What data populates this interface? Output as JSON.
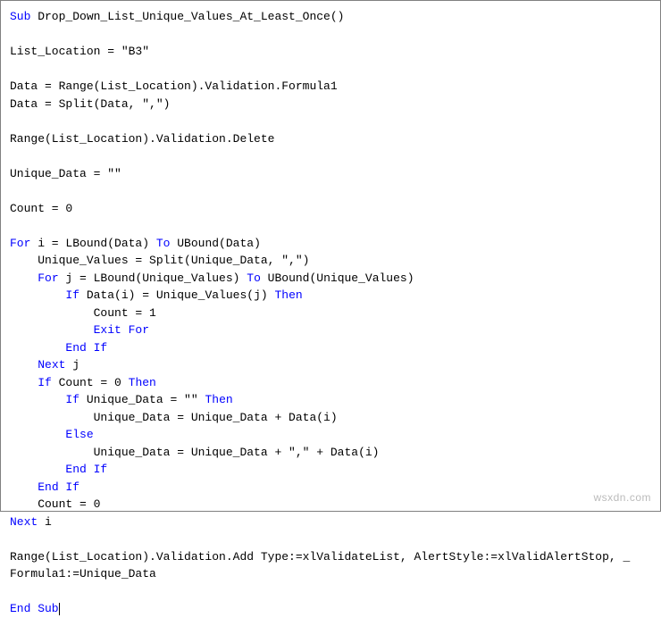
{
  "code": {
    "l1_kw1": "Sub",
    "l1_norm": " Drop_Down_List_Unique_Values_At_Least_Once()",
    "l3": "List_Location = \"B3\"",
    "l5": "Data = Range(List_Location).Validation.Formula1",
    "l6": "Data = Split(Data, \",\")",
    "l8": "Range(List_Location).Validation.Delete",
    "l10": "Unique_Data = \"\"",
    "l12": "Count = 0",
    "l14_kw1": "For",
    "l14_norm1": " i = LBound(Data) ",
    "l14_kw2": "To",
    "l14_norm2": " UBound(Data)",
    "l15": "    Unique_Values = Split(Unique_Data, \",\")",
    "l16_pre": "    ",
    "l16_kw1": "For",
    "l16_norm1": " j = LBound(Unique_Values) ",
    "l16_kw2": "To",
    "l16_norm2": " UBound(Unique_Values)",
    "l17_pre": "        ",
    "l17_kw1": "If",
    "l17_norm1": " Data(i) = Unique_Values(j) ",
    "l17_kw2": "Then",
    "l18": "            Count = 1",
    "l19_pre": "            ",
    "l19_kw": "Exit For",
    "l20_pre": "        ",
    "l20_kw": "End If",
    "l21_pre": "    ",
    "l21_kw": "Next",
    "l21_norm": " j",
    "l22_pre": "    ",
    "l22_kw1": "If",
    "l22_norm1": " Count = 0 ",
    "l22_kw2": "Then",
    "l23_pre": "        ",
    "l23_kw1": "If",
    "l23_norm1": " Unique_Data = \"\" ",
    "l23_kw2": "Then",
    "l24": "            Unique_Data = Unique_Data + Data(i)",
    "l25_pre": "        ",
    "l25_kw": "Else",
    "l26": "            Unique_Data = Unique_Data + \",\" + Data(i)",
    "l27_pre": "        ",
    "l27_kw": "End If",
    "l28_pre": "    ",
    "l28_kw": "End If",
    "l29": "    Count = 0",
    "l30_kw": "Next",
    "l30_norm": " i",
    "l32": "Range(List_Location).Validation.Add Type:=xlValidateList, AlertStyle:=xlValidAlertStop, _",
    "l33": "Formula1:=Unique_Data",
    "l35_kw": "End Sub"
  },
  "watermark": "wsxdn.com"
}
